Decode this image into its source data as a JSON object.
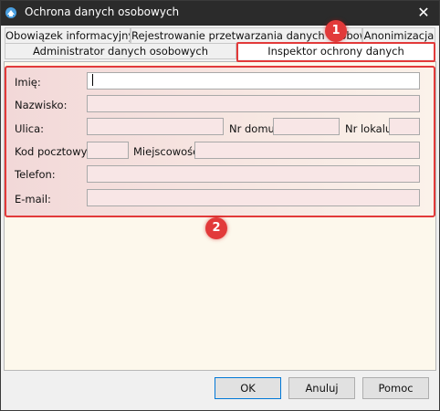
{
  "window": {
    "title": "Ochrona danych osobowych",
    "close_glyph": "✕"
  },
  "tabs_row1": [
    "Obowiązek informacyjny",
    "Rejestrowanie przetwarzania danych osobowych",
    "Anonimizacja"
  ],
  "tabs_row2": [
    "Administrator danych osobowych",
    "Inspektor ochrony danych"
  ],
  "active_tab": "Inspektor ochrony danych",
  "form": {
    "imie_label": "Imię:",
    "nazwisko_label": "Nazwisko:",
    "ulica_label": "Ulica:",
    "nr_domu_label": "Nr domu:",
    "nr_lokalu_label": "Nr lokalu:",
    "kod_label": "Kod pocztowy:",
    "miejscowosc_label": "Miejscowość:",
    "telefon_label": "Telefon:",
    "email_label": "E-mail:",
    "imie_value": "",
    "nazwisko_value": "",
    "ulica_value": "",
    "nr_domu_value": "",
    "nr_lokalu_value": "",
    "kod_value": "",
    "miejscowosc_value": "",
    "telefon_value": "",
    "email_value": ""
  },
  "annotations": {
    "badge1": "1",
    "badge2": "2"
  },
  "buttons": {
    "ok": "OK",
    "cancel": "Anuluj",
    "help": "Pomoc"
  },
  "colors": {
    "highlight": "#e23a3a",
    "panel_bg": "#fdf8ec",
    "default_button_border": "#0078d7"
  }
}
